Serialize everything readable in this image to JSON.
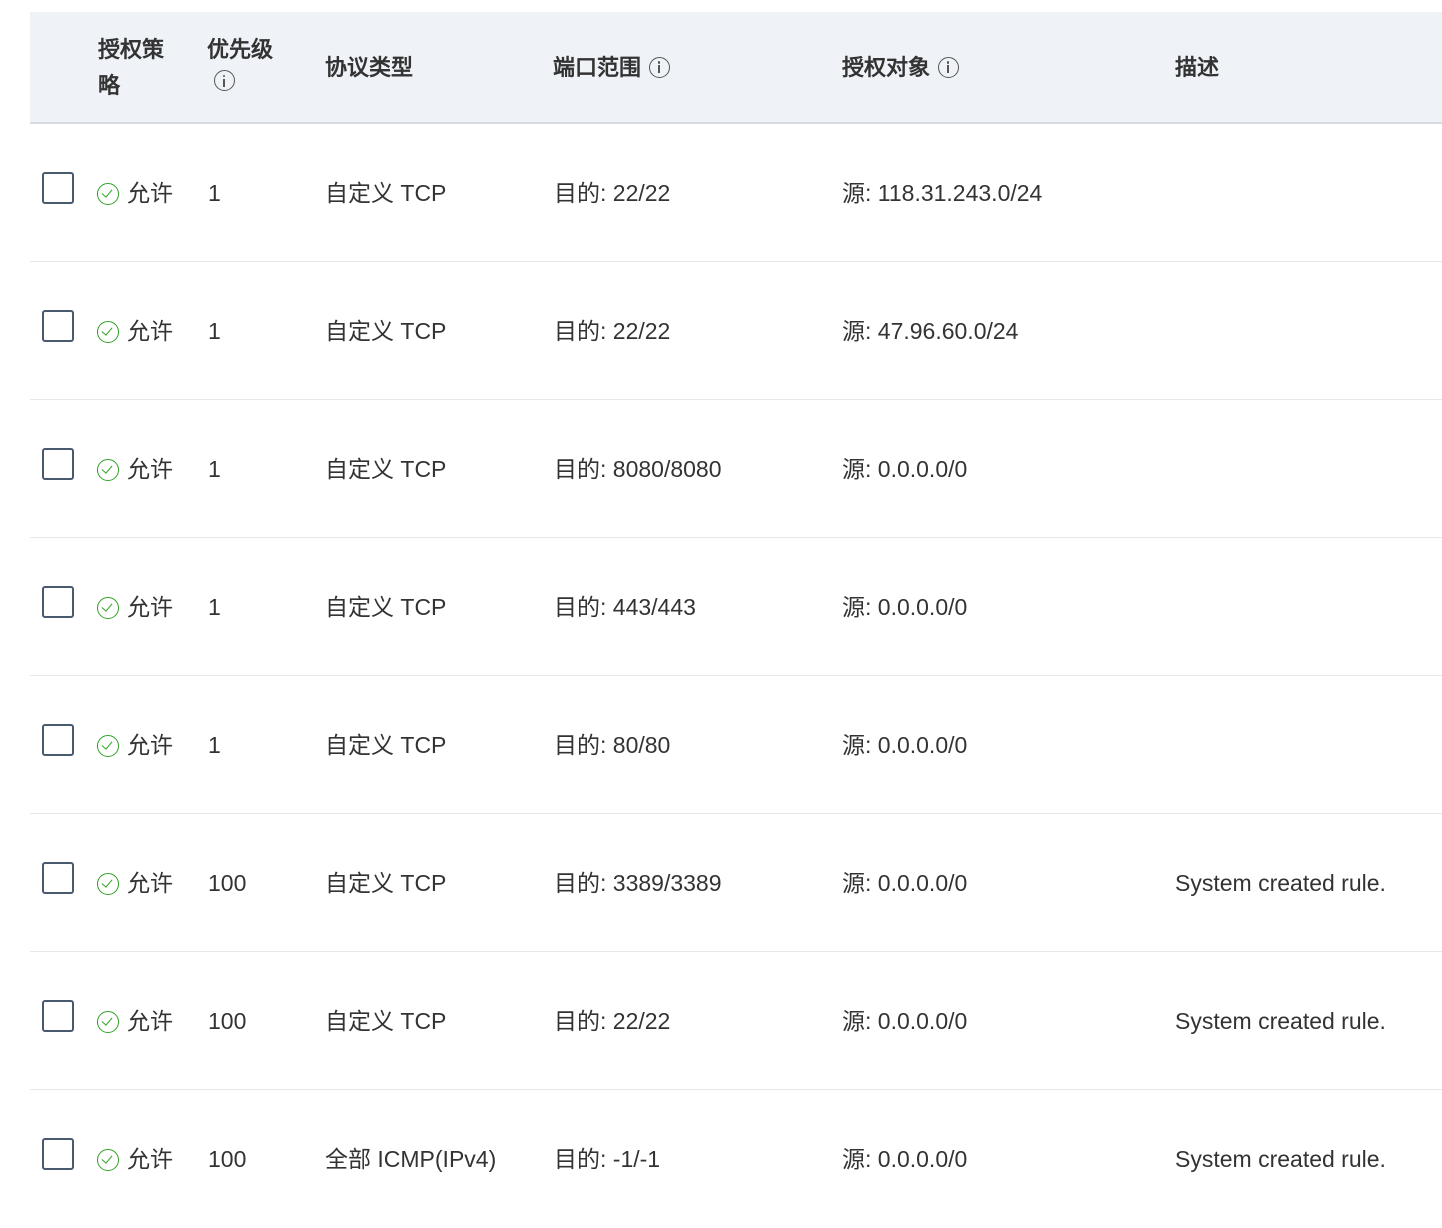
{
  "table": {
    "headers": {
      "policy": "授权策略",
      "priority": "优先级",
      "protocol": "协议类型",
      "port_range": "端口范围",
      "auth_object": "授权对象",
      "description": "描述"
    },
    "rows": [
      {
        "policy": "允许",
        "priority": "1",
        "protocol": "自定义 TCP",
        "port": "目的: 22/22",
        "source": "源: 118.31.243.0/24",
        "description": ""
      },
      {
        "policy": "允许",
        "priority": "1",
        "protocol": "自定义 TCP",
        "port": "目的: 22/22",
        "source": "源: 47.96.60.0/24",
        "description": ""
      },
      {
        "policy": "允许",
        "priority": "1",
        "protocol": "自定义 TCP",
        "port": "目的: 8080/8080",
        "source": "源: 0.0.0.0/0",
        "description": ""
      },
      {
        "policy": "允许",
        "priority": "1",
        "protocol": "自定义 TCP",
        "port": "目的: 443/443",
        "source": "源: 0.0.0.0/0",
        "description": ""
      },
      {
        "policy": "允许",
        "priority": "1",
        "protocol": "自定义 TCP",
        "port": "目的: 80/80",
        "source": "源: 0.0.0.0/0",
        "description": ""
      },
      {
        "policy": "允许",
        "priority": "100",
        "protocol": "自定义 TCP",
        "port": "目的: 3389/3389",
        "source": "源: 0.0.0.0/0",
        "description": "System created rule."
      },
      {
        "policy": "允许",
        "priority": "100",
        "protocol": "自定义 TCP",
        "port": "目的: 22/22",
        "source": "源: 0.0.0.0/0",
        "description": "System created rule."
      },
      {
        "policy": "允许",
        "priority": "100",
        "protocol": "全部 ICMP(IPv4)",
        "port": "目的: -1/-1",
        "source": "源: 0.0.0.0/0",
        "description": "System created rule."
      }
    ]
  },
  "icons": {
    "allow": "check-circle-icon",
    "info": "info-circle-icon"
  },
  "colors": {
    "header_bg": "#eff3f8",
    "allow_green": "#2ea121",
    "text": "#333333"
  }
}
